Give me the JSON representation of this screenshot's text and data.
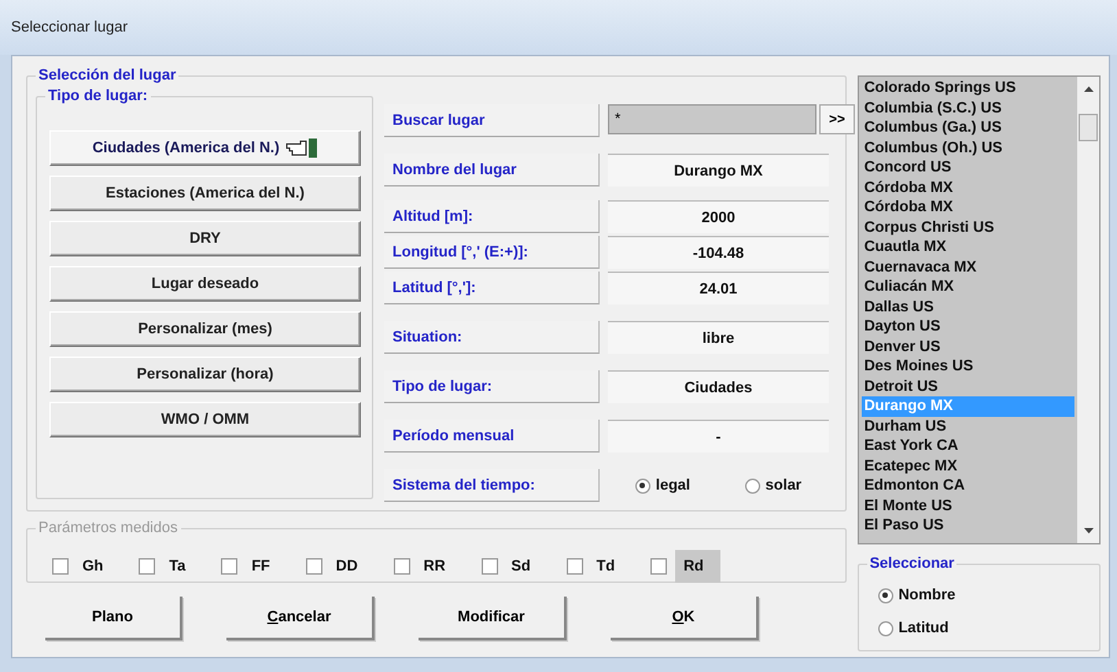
{
  "window": {
    "title": "Seleccionar lugar"
  },
  "place_selection": {
    "legend": "Selección del lugar",
    "place_type": {
      "legend": "Tipo de lugar:",
      "buttons": [
        {
          "label": "Ciudades (America del N.)",
          "selected": true
        },
        {
          "label": "Estaciones (America del N.)",
          "selected": false
        },
        {
          "label": "DRY",
          "selected": false
        },
        {
          "label": "Lugar deseado",
          "selected": false
        },
        {
          "label": "Personalizar (mes)",
          "selected": false
        },
        {
          "label": "Personalizar (hora)",
          "selected": false
        },
        {
          "label": "WMO / OMM",
          "selected": false
        }
      ]
    },
    "fields": [
      {
        "kind": "search",
        "label": "Buscar lugar",
        "value": "*",
        "button": ">>"
      },
      {
        "kind": "value",
        "label": "Nombre del lugar",
        "value": "Durango MX"
      },
      {
        "kind": "value",
        "label": "Altitud [m]:",
        "value": "2000"
      },
      {
        "kind": "value",
        "label": "Longitud [°,' (E:+)]:",
        "value": "-104.48"
      },
      {
        "kind": "value",
        "label": "Latitud [°,']:",
        "value": "24.01"
      },
      {
        "kind": "value",
        "label": "Situation:",
        "value": "libre"
      },
      {
        "kind": "value",
        "label": "Tipo de lugar:",
        "value": "Ciudades"
      },
      {
        "kind": "value",
        "label": "Período mensual",
        "value": "-"
      },
      {
        "kind": "radio",
        "label": "Sistema del tiempo:",
        "options": [
          {
            "label": "legal",
            "selected": true
          },
          {
            "label": "solar",
            "selected": false
          }
        ]
      }
    ]
  },
  "parameters": {
    "legend": "Parámetros medidos",
    "items": [
      {
        "label": "Gh",
        "checked": false,
        "focused": false
      },
      {
        "label": "Ta",
        "checked": false,
        "focused": false
      },
      {
        "label": "FF",
        "checked": false,
        "focused": false
      },
      {
        "label": "DD",
        "checked": false,
        "focused": false
      },
      {
        "label": "RR",
        "checked": false,
        "focused": false
      },
      {
        "label": "Sd",
        "checked": false,
        "focused": false
      },
      {
        "label": "Td",
        "checked": false,
        "focused": false
      },
      {
        "label": "Rd",
        "checked": false,
        "focused": true
      }
    ]
  },
  "buttons": [
    {
      "label": "Plano",
      "mnemonic": false
    },
    {
      "label": "Cancelar",
      "mnemonic": true
    },
    {
      "label": "Modificar",
      "mnemonic": false
    },
    {
      "label": "OK",
      "mnemonic": true
    }
  ],
  "place_list": {
    "items": [
      {
        "label": "Colorado Springs US",
        "selected": false
      },
      {
        "label": "Columbia (S.C.) US",
        "selected": false
      },
      {
        "label": "Columbus (Ga.) US",
        "selected": false
      },
      {
        "label": "Columbus (Oh.) US",
        "selected": false
      },
      {
        "label": "Concord US",
        "selected": false
      },
      {
        "label": "Córdoba MX",
        "selected": false
      },
      {
        "label": "Córdoba MX",
        "selected": false
      },
      {
        "label": "Corpus Christi US",
        "selected": false
      },
      {
        "label": "Cuautla MX",
        "selected": false
      },
      {
        "label": "Cuernavaca MX",
        "selected": false
      },
      {
        "label": "Culiacán MX",
        "selected": false
      },
      {
        "label": "Dallas US",
        "selected": false
      },
      {
        "label": "Dayton US",
        "selected": false
      },
      {
        "label": "Denver US",
        "selected": false
      },
      {
        "label": "Des Moines US",
        "selected": false
      },
      {
        "label": "Detroit US",
        "selected": false
      },
      {
        "label": "Durango MX",
        "selected": true
      },
      {
        "label": "Durham US",
        "selected": false
      },
      {
        "label": "East York CA",
        "selected": false
      },
      {
        "label": "Ecatepec MX",
        "selected": false
      },
      {
        "label": "Edmonton CA",
        "selected": false
      },
      {
        "label": "El Monte US",
        "selected": false
      },
      {
        "label": "El Paso US",
        "selected": false
      }
    ]
  },
  "sort_by": {
    "legend": "Seleccionar",
    "options": [
      {
        "label": "Nombre",
        "selected": true
      },
      {
        "label": "Latitud",
        "selected": false
      }
    ]
  }
}
